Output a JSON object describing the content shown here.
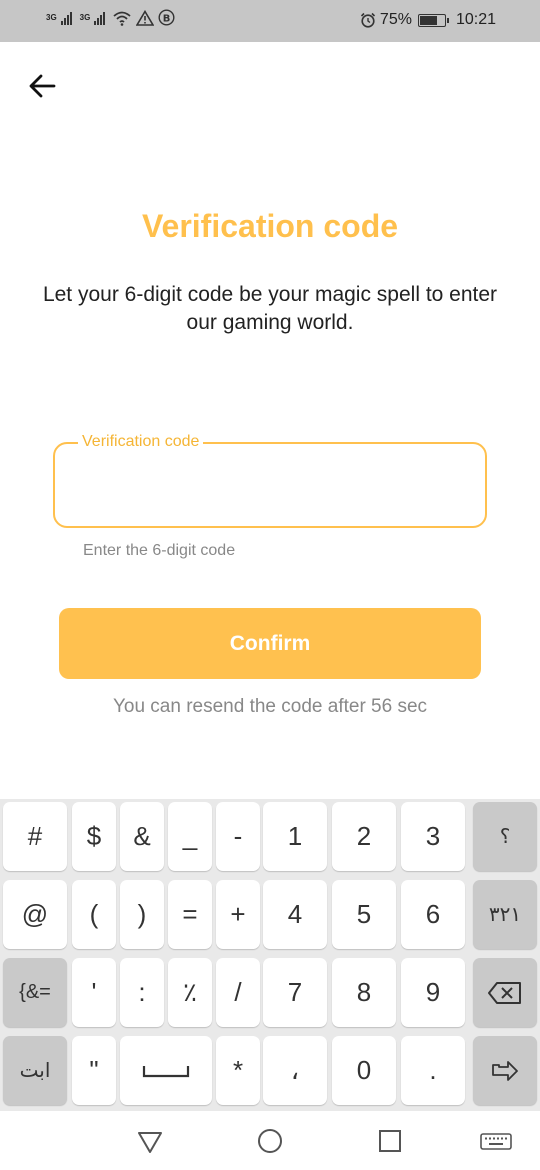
{
  "status_bar": {
    "network_1": "3G",
    "network_2": "3G",
    "battery": "75%",
    "time": "10:21",
    "battery_level": 0.75
  },
  "screen": {
    "title": "Verification code",
    "subtitle": "Let your 6-digit code be your magic spell to enter our gaming world.",
    "field_label": "Verification code",
    "field_value": "",
    "helper": "Enter the 6-digit code",
    "confirm_label": "Confirm",
    "resend_text": "You can resend the code after 56 sec"
  },
  "keyboard": {
    "row1": [
      "#",
      "$",
      "&",
      "_",
      "-",
      "1",
      "2",
      "3",
      "؟"
    ],
    "row2": [
      "@",
      "(",
      ")",
      "=",
      "+",
      "4",
      "5",
      "6",
      "٣٢١"
    ],
    "row3": [
      "{&=",
      "'",
      ":",
      "٪",
      "/",
      "7",
      "8",
      "9"
    ],
    "row4": [
      "ابت",
      "\"",
      "*",
      "،",
      "0",
      "."
    ]
  },
  "colors": {
    "accent": "#ffc04d",
    "button": "#ffc14f",
    "muted": "#888888"
  },
  "icons": {
    "back": "arrow-left-icon",
    "backspace": "backspace-icon",
    "enter": "enter-icon",
    "space": "space-icon",
    "nav_back": "triangle-back-icon",
    "nav_home": "circle-home-icon",
    "nav_recents": "square-recents-icon",
    "nav_keyboard": "keyboard-icon"
  }
}
